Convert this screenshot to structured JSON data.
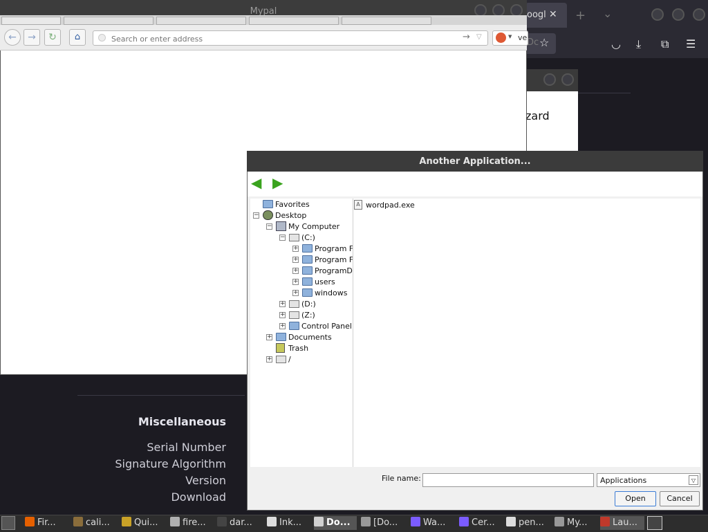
{
  "firefox_bg": {
    "tab_title": "oogl",
    "tab_close": "✕",
    "new_tab": "+",
    "tab_list": "⌄",
    "url_fragment": "Dc",
    "wizard_text": "zard",
    "cert_section_heading": "Miscellaneous",
    "cert_items": [
      "Serial Number",
      "Signature Algorithm",
      "Version",
      "Download"
    ]
  },
  "mypal": {
    "title": "Mypal",
    "url_placeholder": "Search or enter address",
    "search_engine_text": "ve"
  },
  "dialog": {
    "title": "Another Application...",
    "tree": [
      {
        "label": "Favorites",
        "icon": "folder"
      },
      {
        "label": "Desktop",
        "icon": "desktop",
        "expander": "−"
      },
      {
        "label": "My Computer",
        "icon": "computer",
        "expander": "−"
      },
      {
        "label": "(C:)",
        "icon": "drive",
        "expander": "−"
      },
      {
        "label": "Program Fi",
        "icon": "folder",
        "expander": "+"
      },
      {
        "label": "Program Fi",
        "icon": "folder",
        "expander": "+"
      },
      {
        "label": "ProgramDa",
        "icon": "folder",
        "expander": "+"
      },
      {
        "label": "users",
        "icon": "folder",
        "expander": "+"
      },
      {
        "label": "windows",
        "icon": "folder",
        "expander": "+"
      },
      {
        "label": "(D:)",
        "icon": "drive",
        "expander": "+"
      },
      {
        "label": "(Z:)",
        "icon": "drive",
        "expander": "+"
      },
      {
        "label": "Control Panel",
        "icon": "folder",
        "expander": "+"
      },
      {
        "label": "Documents",
        "icon": "folder",
        "expander": "+"
      },
      {
        "label": "Trash",
        "icon": "trash"
      },
      {
        "label": "/",
        "icon": "drive",
        "expander": "+"
      }
    ],
    "files": [
      "wordpad.exe"
    ],
    "file_name_label": "File name:",
    "file_name_value": "",
    "file_type": "Applications",
    "open_label": "Open",
    "cancel_label": "Cancel"
  },
  "taskbar": {
    "items": [
      {
        "label": "Fir...",
        "color": "#e66000"
      },
      {
        "label": "cali...",
        "color": "#8a6d3b"
      },
      {
        "label": "Qui...",
        "color": "#c9a227"
      },
      {
        "label": "fire...",
        "color": "#b0b0b0"
      },
      {
        "label": "dar...",
        "color": "#444444"
      },
      {
        "label": "Ink...",
        "color": "#dddddd"
      },
      {
        "label": "Do...",
        "color": "#d0d0d0",
        "active": true
      },
      {
        "label": "[Do...",
        "color": "#999999"
      },
      {
        "label": "Wa...",
        "color": "#7b5cff"
      },
      {
        "label": "Cer...",
        "color": "#7b5cff"
      },
      {
        "label": "pen...",
        "color": "#dddddd"
      },
      {
        "label": "My...",
        "color": "#999999"
      },
      {
        "label": "Lau...",
        "color": "#c0392b",
        "active": true
      }
    ]
  }
}
